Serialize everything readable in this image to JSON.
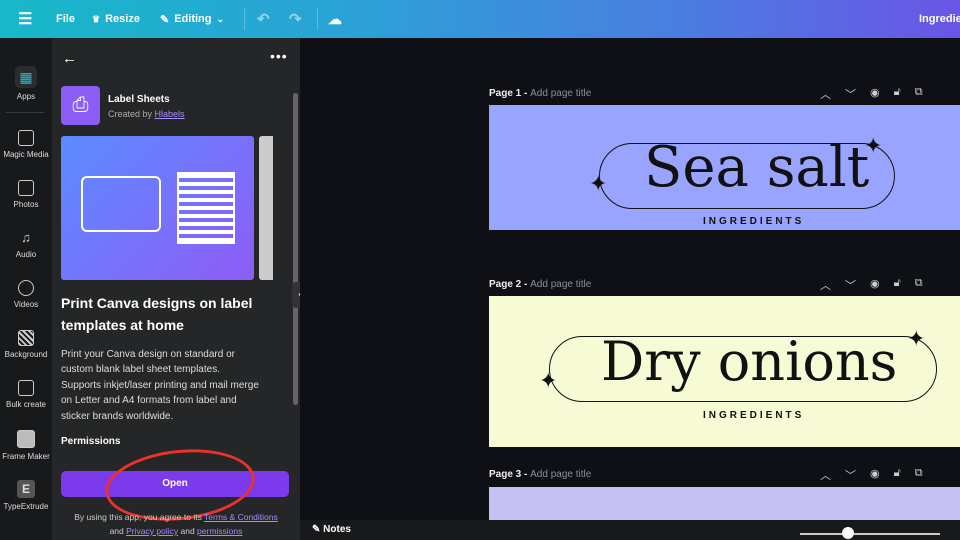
{
  "topbar": {
    "file": "File",
    "resize": "Resize",
    "editing": "Editing",
    "title": "Ingredie"
  },
  "sidebar": {
    "items": [
      {
        "label": "Apps"
      },
      {
        "label": "Magic Media"
      },
      {
        "label": "Photos"
      },
      {
        "label": "Audio"
      },
      {
        "label": "Videos"
      },
      {
        "label": "Background"
      },
      {
        "label": "Bulk create"
      },
      {
        "label": "Frame Maker"
      },
      {
        "label": "TypeExtrude"
      }
    ]
  },
  "panel": {
    "app_name": "Label Sheets",
    "created_by": "Created by",
    "author": "Hlabels",
    "heading": "Print Canva designs on label templates at home",
    "description": "Print your Canva design on standard or custom blank label sheet templates. Supports inkjet/laser printing and mail merge on Letter and A4 formats from label and sticker brands worldwide.",
    "permissions": "Permissions",
    "open": "Open",
    "legal_prefix": "By using this app, you agree to its",
    "terms": "Terms & Conditions",
    "and1": "and",
    "privacy": "Privacy policy",
    "and2": "and",
    "perms_link": "permissions"
  },
  "pages": [
    {
      "label": "Page 1 -",
      "title_placeholder": "Add page title",
      "design_text": "Sea salt",
      "subtitle": "INGREDIENTS",
      "bg": "#99a4ff"
    },
    {
      "label": "Page 2 -",
      "title_placeholder": "Add page title",
      "design_text": "Dry onions",
      "subtitle": "INGREDIENTS",
      "bg": "#f6fbd5"
    },
    {
      "label": "Page 3 -",
      "title_placeholder": "Add page title",
      "bg": "#c5c0f2"
    }
  ],
  "footer": {
    "notes": "Notes"
  },
  "colors": {
    "accent": "#7c3aed",
    "annotation": "#e8322a"
  }
}
